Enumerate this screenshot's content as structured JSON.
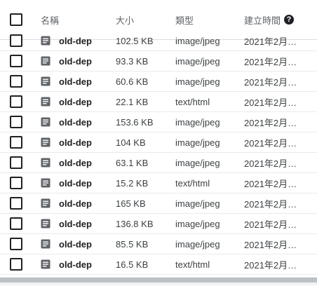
{
  "header": {
    "name_label": "名稱",
    "size_label": "大小",
    "type_label": "類型",
    "created_label": "建立時間",
    "help_glyph": "?"
  },
  "icons": {
    "file": "file-document-icon",
    "help": "help-circle-icon",
    "checkbox": "checkbox-unchecked"
  },
  "colors": {
    "text": "#3c4043",
    "muted": "#5f6368",
    "divider": "#e8eaed",
    "icon": "#5f6368"
  },
  "rows": [
    {
      "name": "old-depe",
      "size": "102.5 KB",
      "type": "image/jpeg",
      "created": "2021年2月…"
    },
    {
      "name": "old-depe",
      "size": "93.3 KB",
      "type": "image/jpeg",
      "created": "2021年2月…"
    },
    {
      "name": "old-depe",
      "size": "60.6 KB",
      "type": "image/jpeg",
      "created": "2021年2月…"
    },
    {
      "name": "old-depe",
      "size": "22.1 KB",
      "type": "text/html",
      "created": "2021年2月…"
    },
    {
      "name": "old-depe",
      "size": "153.6 KB",
      "type": "image/jpeg",
      "created": "2021年2月…"
    },
    {
      "name": "old-depe",
      "size": "104 KB",
      "type": "image/jpeg",
      "created": "2021年2月…"
    },
    {
      "name": "old-depe",
      "size": "63.1 KB",
      "type": "image/jpeg",
      "created": "2021年2月…"
    },
    {
      "name": "old-depe",
      "size": "15.2 KB",
      "type": "text/html",
      "created": "2021年2月…"
    },
    {
      "name": "old-depe",
      "size": "165 KB",
      "type": "image/jpeg",
      "created": "2021年2月…"
    },
    {
      "name": "old-depe",
      "size": "136.8 KB",
      "type": "image/jpeg",
      "created": "2021年2月…"
    },
    {
      "name": "old-depe",
      "size": "85.5 KB",
      "type": "image/jpeg",
      "created": "2021年2月…"
    },
    {
      "name": "old-depe",
      "size": "16.5 KB",
      "type": "text/html",
      "created": "2021年2月…"
    }
  ]
}
